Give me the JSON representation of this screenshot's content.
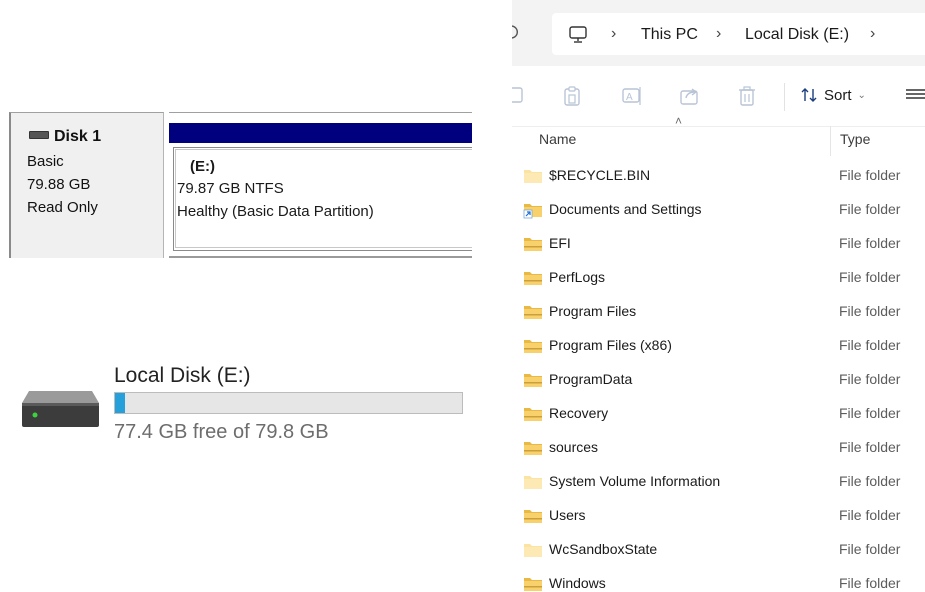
{
  "disk_management": {
    "disk_name": "Disk 1",
    "disk_type": "Basic",
    "disk_size": "79.88 GB",
    "disk_status": "Read Only",
    "partition_label": "(E:)",
    "partition_size_fs": "79.87 GB NTFS",
    "partition_health": "Healthy (Basic Data Partition)",
    "partition_bar_color": "#00007f"
  },
  "drive_tile": {
    "title": "Local Disk (E:)",
    "free_text": "77.4 GB free of 79.8 GB",
    "used_fraction": 0.03,
    "bar_color": "#26a0da",
    "icon": "hard-drive-icon"
  },
  "explorer": {
    "breadcrumb": [
      "This PC",
      "Local Disk (E:)"
    ],
    "toolbar": {
      "sort_label": "Sort",
      "icons": [
        "copy-icon",
        "paste-icon",
        "rename-icon",
        "share-icon",
        "delete-icon",
        "sort-icon",
        "view-menu-icon"
      ]
    },
    "columns": {
      "name": "Name",
      "type": "Type"
    },
    "rows": [
      {
        "name": "$RECYCLE.BIN",
        "type": "File folder",
        "icon": "hidden-folder-icon"
      },
      {
        "name": "Documents and Settings",
        "type": "File folder",
        "icon": "shortcut-folder-icon"
      },
      {
        "name": "EFI",
        "type": "File folder",
        "icon": "folder-icon"
      },
      {
        "name": "PerfLogs",
        "type": "File folder",
        "icon": "folder-icon"
      },
      {
        "name": "Program Files",
        "type": "File folder",
        "icon": "folder-icon"
      },
      {
        "name": "Program Files (x86)",
        "type": "File folder",
        "icon": "folder-icon"
      },
      {
        "name": "ProgramData",
        "type": "File folder",
        "icon": "folder-icon"
      },
      {
        "name": "Recovery",
        "type": "File folder",
        "icon": "folder-icon"
      },
      {
        "name": "sources",
        "type": "File folder",
        "icon": "folder-icon"
      },
      {
        "name": "System Volume Information",
        "type": "File folder",
        "icon": "hidden-folder-icon"
      },
      {
        "name": "Users",
        "type": "File folder",
        "icon": "folder-icon"
      },
      {
        "name": "WcSandboxState",
        "type": "File folder",
        "icon": "hidden-folder-icon"
      },
      {
        "name": "Windows",
        "type": "File folder",
        "icon": "folder-icon"
      }
    ]
  }
}
